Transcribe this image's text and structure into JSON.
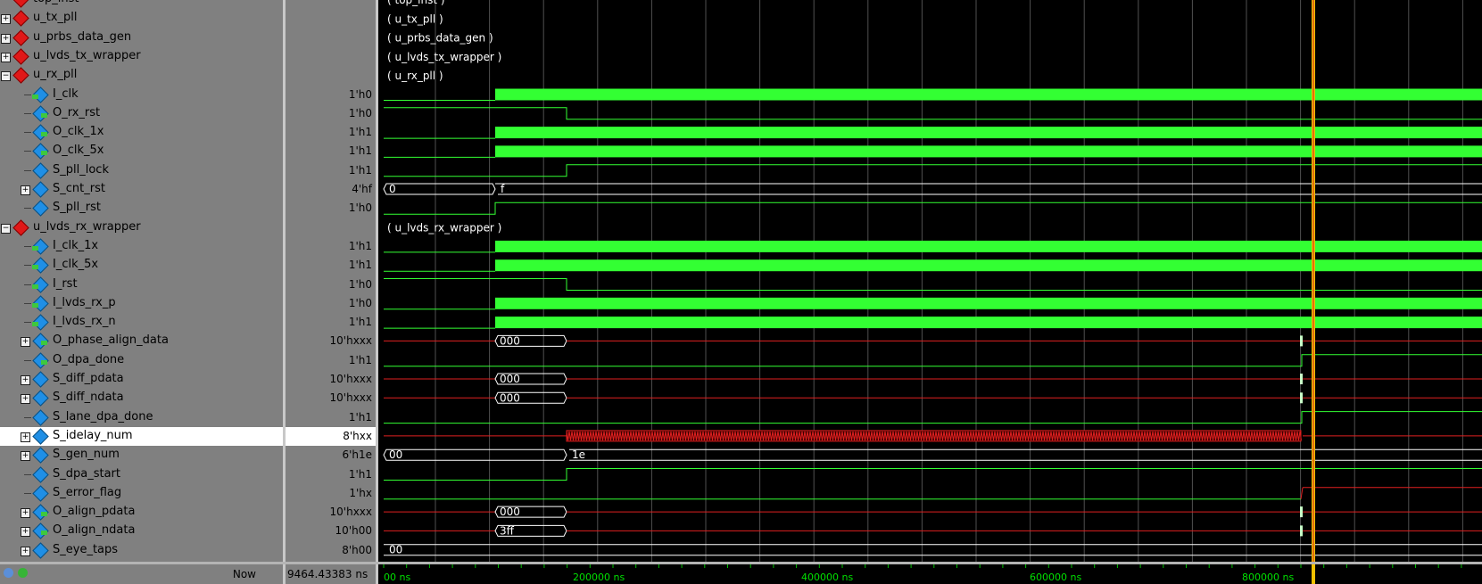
{
  "signals": [
    {
      "name": "top_inst",
      "depth": 0,
      "kind": "module",
      "expander": "none",
      "value": ""
    },
    {
      "name": "u_tx_pll",
      "depth": 0,
      "kind": "module",
      "expander": "plus",
      "value": ""
    },
    {
      "name": "u_prbs_data_gen",
      "depth": 0,
      "kind": "module",
      "expander": "plus",
      "value": ""
    },
    {
      "name": "u_lvds_tx_wrapper",
      "depth": 0,
      "kind": "module",
      "expander": "plus",
      "value": ""
    },
    {
      "name": "u_rx_pll",
      "depth": 0,
      "kind": "module",
      "expander": "minus",
      "value": ""
    },
    {
      "name": "I_clk",
      "depth": 1,
      "kind": "in",
      "expander": "none",
      "value": "1'h0"
    },
    {
      "name": "O_rx_rst",
      "depth": 1,
      "kind": "out",
      "expander": "none",
      "value": "1'h0"
    },
    {
      "name": "O_clk_1x",
      "depth": 1,
      "kind": "out",
      "expander": "none",
      "value": "1'h1"
    },
    {
      "name": "O_clk_5x",
      "depth": 1,
      "kind": "out",
      "expander": "none",
      "value": "1'h1"
    },
    {
      "name": "S_pll_lock",
      "depth": 1,
      "kind": "sig",
      "expander": "none",
      "value": "1'h1"
    },
    {
      "name": "S_cnt_rst",
      "depth": 1,
      "kind": "sig",
      "expander": "plus",
      "value": "4'hf"
    },
    {
      "name": "S_pll_rst",
      "depth": 1,
      "kind": "sig",
      "expander": "none",
      "value": "1'h0"
    },
    {
      "name": "u_lvds_rx_wrapper",
      "depth": 0,
      "kind": "module",
      "expander": "minus",
      "value": ""
    },
    {
      "name": "I_clk_1x",
      "depth": 1,
      "kind": "in",
      "expander": "none",
      "value": "1'h1"
    },
    {
      "name": "I_clk_5x",
      "depth": 1,
      "kind": "in",
      "expander": "none",
      "value": "1'h1"
    },
    {
      "name": "I_rst",
      "depth": 1,
      "kind": "in",
      "expander": "none",
      "value": "1'h0"
    },
    {
      "name": "I_lvds_rx_p",
      "depth": 1,
      "kind": "in",
      "expander": "none",
      "value": "1'h0"
    },
    {
      "name": "I_lvds_rx_n",
      "depth": 1,
      "kind": "in",
      "expander": "none",
      "value": "1'h1"
    },
    {
      "name": "O_phase_align_data",
      "depth": 1,
      "kind": "out",
      "expander": "plus",
      "value": "10'hxxx"
    },
    {
      "name": "O_dpa_done",
      "depth": 1,
      "kind": "out",
      "expander": "none",
      "value": "1'h1"
    },
    {
      "name": "S_diff_pdata",
      "depth": 1,
      "kind": "sig",
      "expander": "plus",
      "value": "10'hxxx"
    },
    {
      "name": "S_diff_ndata",
      "depth": 1,
      "kind": "sig",
      "expander": "plus",
      "value": "10'hxxx"
    },
    {
      "name": "S_lane_dpa_done",
      "depth": 1,
      "kind": "sig",
      "expander": "none",
      "value": "1'h1"
    },
    {
      "name": "S_idelay_num",
      "depth": 1,
      "kind": "sig",
      "expander": "plus",
      "value": "8'hxx",
      "selected": true
    },
    {
      "name": "S_gen_num",
      "depth": 1,
      "kind": "sig",
      "expander": "plus",
      "value": "6'h1e"
    },
    {
      "name": "S_dpa_start",
      "depth": 1,
      "kind": "sig",
      "expander": "none",
      "value": "1'h1"
    },
    {
      "name": "S_error_flag",
      "depth": 1,
      "kind": "sig",
      "expander": "none",
      "value": "1'hx"
    },
    {
      "name": "O_align_pdata",
      "depth": 1,
      "kind": "out",
      "expander": "plus",
      "value": "10'hxxx"
    },
    {
      "name": "O_align_ndata",
      "depth": 1,
      "kind": "out",
      "expander": "plus",
      "value": "10'h00"
    },
    {
      "name": "S_eye_taps",
      "depth": 1,
      "kind": "sig",
      "expander": "plus",
      "value": "8'h00"
    }
  ],
  "module_labels": [
    "( top_inst )",
    "( u_tx_pll )",
    "( u_prbs_data_gen )",
    "( u_lvds_tx_wrapper )",
    "( u_rx_pll )",
    "( u_lvds_rx_wrapper )"
  ],
  "wave_text": {
    "s_cnt_rst_a": "0",
    "s_cnt_rst_b": "f",
    "phase_align": "000",
    "diff_pdata": "000",
    "diff_ndata": "000",
    "gen_num_a": "00",
    "gen_num_b": "1e",
    "align_pdata": "000",
    "align_ndata": "3ff",
    "eye_taps": "00"
  },
  "status": {
    "now_label": "Now",
    "now_value": "9464.43383 ns"
  },
  "timeline": {
    "labels": [
      "00 ns",
      "200000 ns",
      "400000 ns",
      "600000 ns",
      "800000 ns"
    ]
  },
  "colors": {
    "wave_high": "#33ff33",
    "wave_x": "#e02020",
    "cursor": "#f0c000",
    "grid": "#505050",
    "bg": "#000000"
  }
}
